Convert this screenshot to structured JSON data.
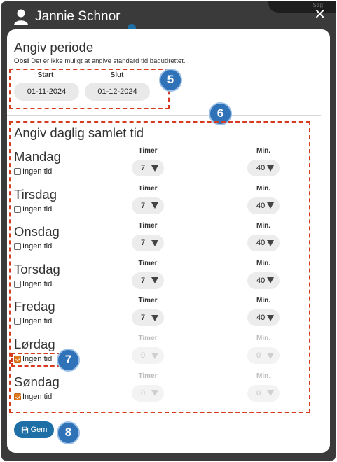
{
  "header": {
    "user_name": "Jannie Schnor",
    "close_glyph": "✕",
    "search_partial": "Søg"
  },
  "period": {
    "title": "Angiv periode",
    "note_bold": "Obs!",
    "note_text": " Det er ikke muligt at angive standard tid bagudrettet.",
    "start_label": "Start",
    "end_label": "Slut",
    "start_value": "01-11-2024",
    "end_value": "01-12-2024"
  },
  "daily": {
    "title": "Angiv daglig samlet tid",
    "hours_label": "Timer",
    "minutes_label": "Min.",
    "no_time_label": "Ingen tid",
    "days": [
      {
        "name": "Mandag",
        "hours": "7",
        "minutes": "40",
        "no_time": false
      },
      {
        "name": "Tirsdag",
        "hours": "7",
        "minutes": "40",
        "no_time": false
      },
      {
        "name": "Onsdag",
        "hours": "7",
        "minutes": "40",
        "no_time": false
      },
      {
        "name": "Torsdag",
        "hours": "7",
        "minutes": "40",
        "no_time": false
      },
      {
        "name": "Fredag",
        "hours": "7",
        "minutes": "40",
        "no_time": false
      },
      {
        "name": "Lørdag",
        "hours": "0",
        "minutes": "0",
        "no_time": true
      },
      {
        "name": "Søndag",
        "hours": "0",
        "minutes": "0",
        "no_time": true
      }
    ]
  },
  "save_label": "Gem",
  "badges": {
    "period": "5",
    "daily": "6",
    "saturday": "7",
    "save": "8"
  },
  "colors": {
    "accent": "#1d6fa5",
    "highlight": "#d63a1f",
    "badge": "#2f72b8",
    "checked": "#e07b1f"
  }
}
